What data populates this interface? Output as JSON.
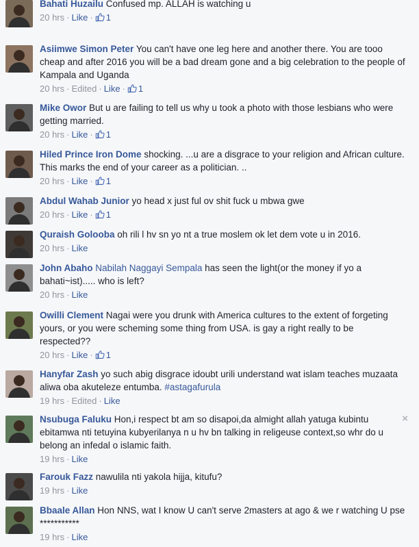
{
  "comments": [
    {
      "author": "Bahati Huzailu",
      "text": "Confused mp. ALLAH is watching u",
      "time": "20 hrs",
      "like_label": "Like",
      "likes": "1",
      "av": "#7a6a58"
    },
    {
      "author": "Asiimwe Simon Peter",
      "text": "You can't have one leg here and another there. You are tooo cheap and after 2016 you will be a bad dream gone and a big celebration to the people of Kampala and Uganda",
      "time": "20 hrs",
      "edited": "Edited",
      "like_label": "Like",
      "likes": "1",
      "av": "#8c7460"
    },
    {
      "author": "Mike Owor",
      "text": "But u are failing to tell us why u took a photo with those lesbians who were getting married.",
      "time": "20 hrs",
      "like_label": "Like",
      "likes": "1",
      "av": "#5e5e5e"
    },
    {
      "author": "Hiled Prince Iron Dome",
      "text": "shocking. ...u are a disgrace to your religion and African culture. This marks the end of your career as a politician. ..",
      "time": "20 hrs",
      "like_label": "Like",
      "likes": "1",
      "av": "#6f5b4d"
    },
    {
      "author": "Abdul Wahab Junior",
      "text": "yo head x just ful ov shit fuck u mbwa gwe",
      "time": "20 hrs",
      "like_label": "Like",
      "likes": "1",
      "av": "#7b7b7b"
    },
    {
      "author": "Quraish Golooba",
      "text": "oh rili l hv sn yo nt a true moslem ok let dem vote u in 2016.",
      "time": "20 hrs",
      "like_label": "Like",
      "av": "#3f3a36"
    },
    {
      "author": "John Abaho",
      "mention": "Nabilah Naggayi Sempala",
      "text": "has seen the light(or the money if yo a bahati~ist)..... who is left?",
      "time": "20 hrs",
      "like_label": "Like",
      "av": "#8e8e8e"
    },
    {
      "author": "Owilli Clement",
      "text": "Nagai were you drunk with America cultures to the extent of forgeting yours, or you were scheming some thing from USA. is gay a right really to be respected??",
      "time": "20 hrs",
      "like_label": "Like",
      "likes": "1",
      "av": "#6d7a4e"
    },
    {
      "author": "Hanyfar Zash",
      "text": "yo such abig disgrace idoubt urili understand wat islam teaches muzaata aliwa oba akuteleze entumba.",
      "hashtag": "#astagafurula",
      "time": "19 hrs",
      "edited": "Edited",
      "like_label": "Like",
      "av": "#b9a9a0"
    },
    {
      "author": "Nsubuga Faluku",
      "text": "Hon,i respect bt am so disapoi,da almight allah yatuga kubintu ebitamwa nti tetuyina kubyerilanya n u hv bn talking in religeuse context,so whr do u belong an infedal o islamic faith.",
      "time": "19 hrs",
      "like_label": "Like",
      "close": "×",
      "av": "#5f7a5a"
    },
    {
      "author": "Farouk Fazz",
      "text": "nawulila nti yakola hijja, kitufu?",
      "time": "19 hrs",
      "like_label": "Like",
      "av": "#4a4a4a"
    },
    {
      "author": "Bbaale Allan",
      "text": "Hon NNS, wat I know U can't serve 2masters at ago & we r watching U pse ***********",
      "time": "19 hrs",
      "like_label": "Like",
      "av": "#5c7050"
    }
  ]
}
